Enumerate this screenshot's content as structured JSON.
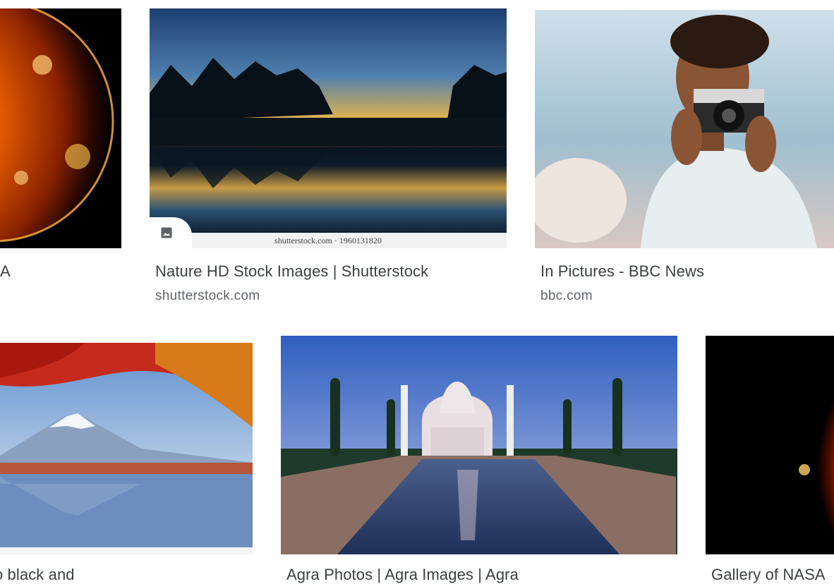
{
  "results": [
    {
      "id": "sun1",
      "title": "A",
      "source": ""
    },
    {
      "id": "nature",
      "title": "Nature HD Stock Images | Shutterstock",
      "source": "shutterstock.com",
      "watermark": "shutterstock.com · 1960131820",
      "badge_icon": "image-icon"
    },
    {
      "id": "bbc",
      "title": "In Pictures - BBC News",
      "source": "bbc.com"
    },
    {
      "id": "fuji",
      "title": "o black and",
      "source": ""
    },
    {
      "id": "agra",
      "title": "Agra Photos | Agra Images | Agra",
      "source": ""
    },
    {
      "id": "sun2",
      "title": "Gallery of NASA",
      "source": ""
    }
  ],
  "colors": {
    "title": "#3c4043",
    "source": "#5f6368"
  }
}
